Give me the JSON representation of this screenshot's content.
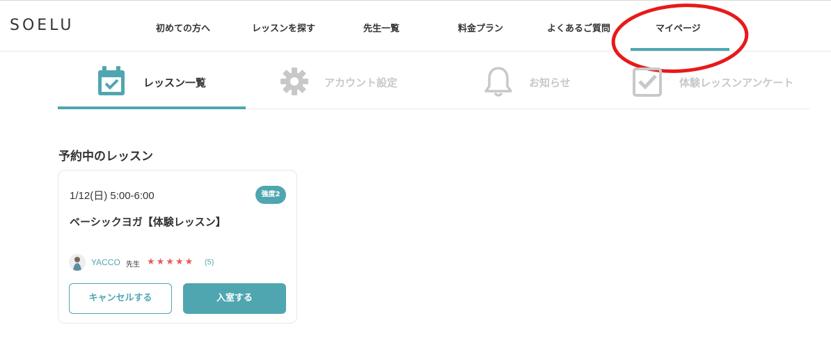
{
  "header": {
    "logo": "SOELU",
    "nav": [
      {
        "label": "初めての方へ"
      },
      {
        "label": "レッスンを探す"
      },
      {
        "label": "先生一覧"
      },
      {
        "label": "料金プラン"
      },
      {
        "label": "よくあるご質問"
      },
      {
        "label": "マイページ",
        "active": true
      }
    ]
  },
  "subtabs": [
    {
      "label": "レッスン一覧",
      "icon": "calendar-check-icon",
      "active": true
    },
    {
      "label": "アカウント設定",
      "icon": "gear-icon",
      "active": false
    },
    {
      "label": "お知らせ",
      "icon": "bell-icon",
      "active": false
    },
    {
      "label": "体験レッスンアンケート",
      "icon": "checkbox-icon",
      "active": false
    }
  ],
  "section": {
    "title": "予約中のレッスン"
  },
  "lesson": {
    "datetime": "1/12(日) 5:00-6:00",
    "intensity": "強度2",
    "title": "ベーシックヨガ【体験レッスン】",
    "teacher": "YACCO",
    "teacher_suffix": "先生",
    "stars": "★★★★★",
    "rating_count": "(5)",
    "cancel_label": "キャンセルする",
    "enter_label": "入室する"
  },
  "colors": {
    "accent": "#4fa6b0",
    "inactive": "#c8c8c8",
    "star": "#e85a5a",
    "annotation": "#e8191a"
  }
}
